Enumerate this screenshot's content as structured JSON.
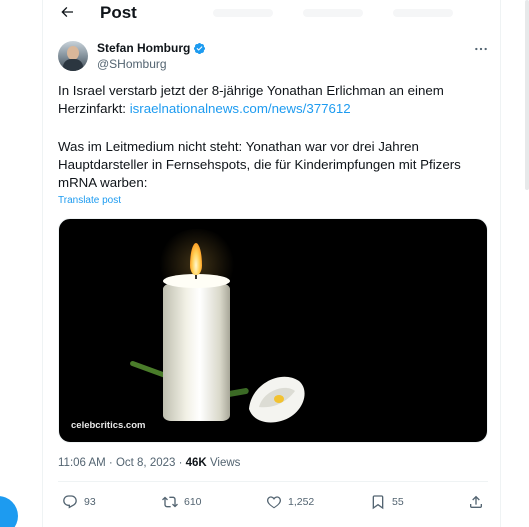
{
  "header": {
    "title": "Post"
  },
  "author": {
    "name": "Stefan Homburg",
    "handle": "@SHomburg"
  },
  "tweet": {
    "line1": "In Israel verstarb jetzt der 8-jährige Yonathan Erlichman an einem",
    "line2_prefix": "Herzinfarkt: ",
    "link": "israelnationalnews.com/news/377612",
    "para2_line1": "Was im Leitmedium nicht steht: Yonathan war vor drei Jahren",
    "para2_line2": "Hauptdarsteller in Fernsehspots, die für Kinderimpfungen mit Pfizers",
    "para2_line3": "mRNA warben:",
    "translate": "Translate post"
  },
  "media": {
    "watermark": "celebcritics.com"
  },
  "meta": {
    "time": "11:06 AM · Oct 8, 2023 · ",
    "views_count": "46K",
    "views_label": " Views"
  },
  "actions": {
    "replies": "93",
    "reposts": "610",
    "likes": "1,252",
    "bookmarks": "55"
  },
  "icons": {
    "back": "arrow-left-icon",
    "verified": "verified-badge-icon",
    "more": "more-icon",
    "reply": "reply-icon",
    "repost": "repost-icon",
    "like": "heart-icon",
    "bookmark": "bookmark-icon",
    "share": "share-icon"
  },
  "colors": {
    "accent": "#1d9bf0",
    "text": "#0f1419",
    "muted": "#536471",
    "repost_green": "#00ba7c"
  }
}
